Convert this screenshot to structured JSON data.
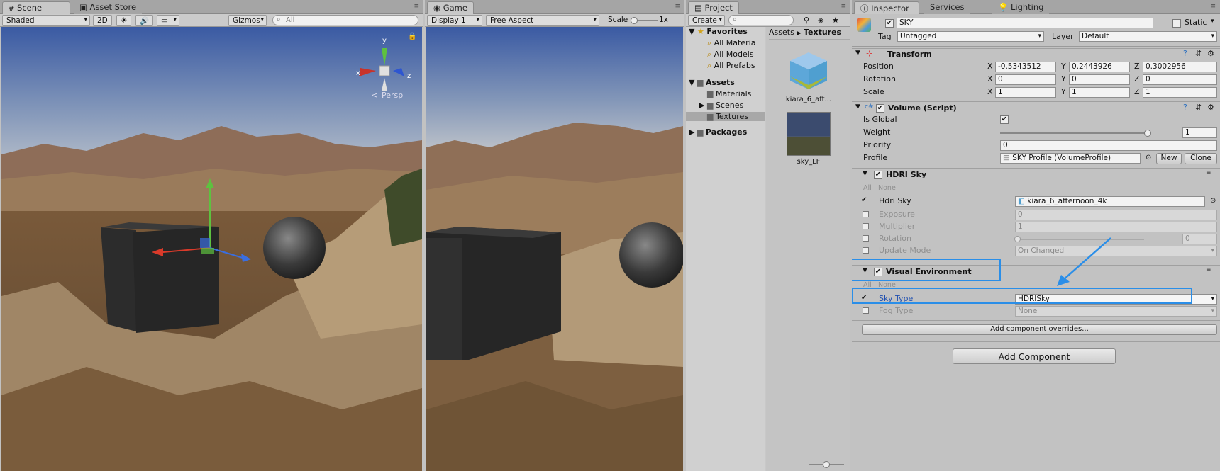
{
  "scene": {
    "tabs": [
      "Scene",
      "Asset Store"
    ],
    "shading": "Shaded",
    "mode_2d": "2D",
    "gizmos": "Gizmos",
    "search_placeholder": "All",
    "axis_x": "x",
    "axis_y": "y",
    "axis_z": "z",
    "persp": "Persp"
  },
  "game": {
    "tab": "Game",
    "display": "Display 1",
    "aspect": "Free Aspect",
    "scale_label": "Scale",
    "scale_value": "1x"
  },
  "project": {
    "tab": "Project",
    "create": "Create",
    "favorites": "Favorites",
    "fav_items": [
      "All Materia",
      "All Models",
      "All Prefabs"
    ],
    "assets": "Assets",
    "asset_items": [
      "Materials",
      "Scenes",
      "Textures"
    ],
    "packages": "Packages",
    "breadcrumb_root": "Assets",
    "breadcrumb_current": "Textures",
    "files": [
      "kiara_6_aft...",
      "sky_LF"
    ]
  },
  "inspector": {
    "tabs": [
      "Inspector",
      "Services",
      "Lighting"
    ],
    "object_name": "SKY",
    "static_label": "Static",
    "tag_label": "Tag",
    "tag_value": "Untagged",
    "layer_label": "Layer",
    "layer_value": "Default",
    "transform": {
      "title": "Transform",
      "rows": [
        {
          "label": "Position",
          "x": "-0.5343512",
          "y": "0.2443926",
          "z": "0.3002956"
        },
        {
          "label": "Rotation",
          "x": "0",
          "y": "0",
          "z": "0"
        },
        {
          "label": "Scale",
          "x": "1",
          "y": "1",
          "z": "1"
        }
      ]
    },
    "volume": {
      "title": "Volume (Script)",
      "is_global": "Is Global",
      "weight": "Weight",
      "weight_value": "1",
      "priority": "Priority",
      "priority_value": "0",
      "profile": "Profile",
      "profile_value": "SKY Profile (VolumeProfile)",
      "new": "New",
      "clone": "Clone"
    },
    "hdri": {
      "title": "HDRI Sky",
      "all": "All",
      "none": "None",
      "hdri_sky": "Hdri Sky",
      "hdri_value": "kiara_6_afternoon_4k",
      "exposure": "Exposure",
      "exposure_value": "0",
      "multiplier": "Multiplier",
      "multiplier_value": "1",
      "rotation": "Rotation",
      "rotation_value": "0",
      "update_mode": "Update Mode",
      "update_value": "On Changed"
    },
    "visual": {
      "title": "Visual Environment",
      "all": "All",
      "none": "None",
      "sky_type": "Sky Type",
      "sky_value": "HDRISky",
      "fog_type": "Fog Type",
      "fog_value": "None"
    },
    "add_overrides": "Add component overrides...",
    "add_component": "Add Component"
  },
  "colors": {
    "highlight": "#2a8ee8",
    "sky_top": "#3d5ea6",
    "sky_horizon": "#a9b6c6"
  }
}
